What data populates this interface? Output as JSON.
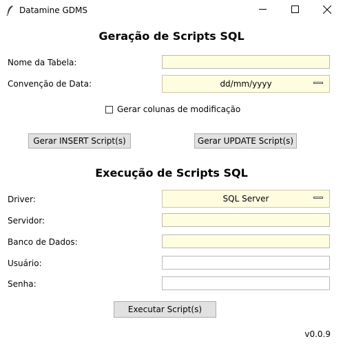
{
  "window": {
    "title": "Datamine GDMS"
  },
  "generation": {
    "title": "Geração de Scripts SQL",
    "table_name_label": "Nome da Tabela:",
    "table_name_value": "",
    "date_format_label": "Convenção de Data:",
    "date_format_value": "dd/mm/yyyy",
    "checkbox_label": "Gerar colunas de modificação",
    "checkbox_checked": false,
    "insert_button": "Gerar INSERT Script(s)",
    "update_button": "Gerar UPDATE Script(s)"
  },
  "execution": {
    "title": "Execução de Scripts SQL",
    "driver_label": "Driver:",
    "driver_value": "SQL Server",
    "server_label": "Servidor:",
    "server_value": "",
    "database_label": "Banco de Dados:",
    "database_value": "",
    "user_label": "Usuário:",
    "user_value": "",
    "password_label": "Senha:",
    "password_value": "",
    "execute_button": "Executar Script(s)"
  },
  "footer": {
    "version": "v0.0.9"
  },
  "colors": {
    "entry_bg": "#fffde0",
    "button_bg": "#e1e1e1"
  }
}
